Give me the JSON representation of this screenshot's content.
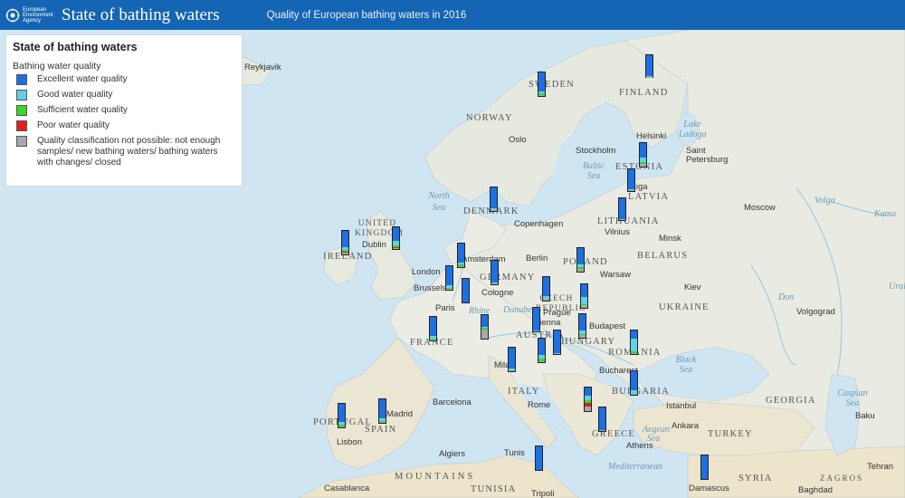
{
  "header": {
    "logo_lines": [
      "European",
      "Environment",
      "Agency"
    ],
    "title": "State of bathing waters",
    "subtitle": "Quality of European bathing waters in 2016"
  },
  "legend": {
    "title": "State of bathing waters",
    "subtitle": "Bathing water quality",
    "items": [
      {
        "label": "Excellent water quality",
        "color": "#1e6fe0"
      },
      {
        "label": "Good water quality",
        "color": "#5fd3e6"
      },
      {
        "label": "Sufficient water quality",
        "color": "#3ad42a"
      },
      {
        "label": "Poor water quality",
        "color": "#e51d1d"
      },
      {
        "label": "Quality classification not possible: not enough samples/ new bathing waters/ bathing waters with changes/ closed",
        "color": "#a8a8a8"
      }
    ]
  },
  "map": {
    "countries": [
      "SWEDEN",
      "FINLAND",
      "NORWAY",
      "ESTONIA",
      "LATVIA",
      "LITHUANIA",
      "DENMARK",
      "UNITED KINGDOM",
      "IRELAND",
      "POLAND",
      "BELARUS",
      "GERMANY",
      "CZECH REPUBLIC",
      "UKRAINE",
      "FRANCE",
      "AUSTRIA",
      "HUNGARY",
      "ROMANIA",
      "BULGARIA",
      "ITALY",
      "PORTUGAL",
      "SPAIN",
      "GREECE",
      "TURKEY",
      "GEORGIA",
      "SYRIA",
      "TUNISIA"
    ],
    "cities": [
      "Reykjavik",
      "Oslo",
      "Stockholm",
      "Helsinki",
      "Saint Petersburg",
      "Moscow",
      "Copenhagen",
      "Riga",
      "Vilnius",
      "Minsk",
      "Dublin",
      "Amsterdam",
      "Berlin",
      "Warsaw",
      "London",
      "Brussels",
      "Cologne",
      "Kiev",
      "Paris",
      "Prague",
      "Vienna",
      "Budapest",
      "Volgograd",
      "Milan",
      "Bucharest",
      "Barcelona",
      "Rome",
      "Istanbul",
      "Ankara",
      "Madrid",
      "Lisbon",
      "Algiers",
      "Tunis",
      "Athens",
      "Tehran",
      "Baku",
      "Damascus",
      "Baghdad",
      "Casablanca",
      "Tripoli"
    ],
    "seas": [
      "North Sea",
      "Baltic Sea",
      "Lake Ladoga",
      "Black Sea",
      "Caspian Sea",
      "Mediterranean",
      "Volga",
      "Kama",
      "Don",
      "Ural",
      "Danube",
      "Rhine",
      "Aegean Sea"
    ],
    "mountains": [
      "MOUNTAINS",
      "ZAGROS"
    ],
    "river_labels": [
      "Volga",
      "Kama",
      "Don",
      "Ural"
    ],
    "stations": [
      {
        "id": "sweden",
        "composition": {
          "excellent": 0.82,
          "good": 0.08,
          "sufficient": 0.05,
          "poor": 0,
          "na": 0.05
        }
      },
      {
        "id": "finland",
        "composition": {
          "excellent": 0.94,
          "good": 0.04,
          "sufficient": 0,
          "poor": 0,
          "na": 0.02
        }
      },
      {
        "id": "estonia",
        "composition": {
          "excellent": 0.6,
          "good": 0.2,
          "sufficient": 0.1,
          "poor": 0,
          "na": 0.1
        }
      },
      {
        "id": "latvia",
        "composition": {
          "excellent": 0.9,
          "good": 0.05,
          "sufficient": 0,
          "poor": 0,
          "na": 0.05
        }
      },
      {
        "id": "lithuania",
        "composition": {
          "excellent": 0.95,
          "good": 0.05,
          "sufficient": 0,
          "poor": 0,
          "na": 0
        }
      },
      {
        "id": "denmark",
        "composition": {
          "excellent": 0.9,
          "good": 0.05,
          "sufficient": 0.03,
          "poor": 0,
          "na": 0.02
        }
      },
      {
        "id": "ireland",
        "composition": {
          "excellent": 0.7,
          "good": 0.12,
          "sufficient": 0.08,
          "poor": 0.04,
          "na": 0.06
        }
      },
      {
        "id": "uk",
        "composition": {
          "excellent": 0.62,
          "good": 0.22,
          "sufficient": 0.08,
          "poor": 0.04,
          "na": 0.04
        }
      },
      {
        "id": "netherlands",
        "composition": {
          "excellent": 0.8,
          "good": 0.1,
          "sufficient": 0.05,
          "poor": 0,
          "na": 0.05
        }
      },
      {
        "id": "belgium",
        "composition": {
          "excellent": 0.82,
          "good": 0.1,
          "sufficient": 0.04,
          "poor": 0,
          "na": 0.04
        }
      },
      {
        "id": "luxembourg",
        "composition": {
          "excellent": 1,
          "good": 0,
          "sufficient": 0,
          "poor": 0,
          "na": 0
        }
      },
      {
        "id": "germany",
        "composition": {
          "excellent": 0.92,
          "good": 0.04,
          "sufficient": 0,
          "poor": 0,
          "na": 0.04
        }
      },
      {
        "id": "poland",
        "composition": {
          "excellent": 0.7,
          "good": 0.1,
          "sufficient": 0.1,
          "poor": 0,
          "na": 0.1
        }
      },
      {
        "id": "czech",
        "composition": {
          "excellent": 0.82,
          "good": 0.1,
          "sufficient": 0,
          "poor": 0,
          "na": 0.08
        }
      },
      {
        "id": "slovakia",
        "composition": {
          "excellent": 0.55,
          "good": 0.3,
          "sufficient": 0.05,
          "poor": 0,
          "na": 0.1
        }
      },
      {
        "id": "france",
        "composition": {
          "excellent": 0.8,
          "good": 0.12,
          "sufficient": 0.04,
          "poor": 0,
          "na": 0.04
        }
      },
      {
        "id": "switzerland",
        "composition": {
          "excellent": 0.5,
          "good": 0.05,
          "sufficient": 0.05,
          "poor": 0,
          "na": 0.4
        }
      },
      {
        "id": "austria",
        "composition": {
          "excellent": 0.95,
          "good": 0.05,
          "sufficient": 0,
          "poor": 0,
          "na": 0
        }
      },
      {
        "id": "hungary",
        "composition": {
          "excellent": 0.7,
          "good": 0.15,
          "sufficient": 0.05,
          "poor": 0,
          "na": 0.1
        }
      },
      {
        "id": "slovenia",
        "composition": {
          "excellent": 0.7,
          "good": 0.15,
          "sufficient": 0.1,
          "poor": 0,
          "na": 0.05
        }
      },
      {
        "id": "croatia",
        "composition": {
          "excellent": 0.95,
          "good": 0.05,
          "sufficient": 0,
          "poor": 0,
          "na": 0
        }
      },
      {
        "id": "romania",
        "composition": {
          "excellent": 0.35,
          "good": 0.55,
          "sufficient": 0.05,
          "poor": 0,
          "na": 0.05
        }
      },
      {
        "id": "bulgaria",
        "composition": {
          "excellent": 0.8,
          "good": 0.15,
          "sufficient": 0,
          "poor": 0,
          "na": 0.05
        }
      },
      {
        "id": "italy",
        "composition": {
          "excellent": 0.9,
          "good": 0.05,
          "sufficient": 0.02,
          "poor": 0.01,
          "na": 0.02
        }
      },
      {
        "id": "portugal",
        "composition": {
          "excellent": 0.75,
          "good": 0.15,
          "sufficient": 0.05,
          "poor": 0,
          "na": 0.05
        }
      },
      {
        "id": "spain",
        "composition": {
          "excellent": 0.82,
          "good": 0.1,
          "sufficient": 0.03,
          "poor": 0.02,
          "na": 0.03
        }
      },
      {
        "id": "albania",
        "composition": {
          "excellent": 0.35,
          "good": 0.2,
          "sufficient": 0.12,
          "poor": 0.15,
          "na": 0.18
        }
      },
      {
        "id": "greece",
        "composition": {
          "excellent": 0.95,
          "good": 0.03,
          "sufficient": 0,
          "poor": 0,
          "na": 0.02
        }
      },
      {
        "id": "malta",
        "composition": {
          "excellent": 1,
          "good": 0,
          "sufficient": 0,
          "poor": 0,
          "na": 0
        }
      },
      {
        "id": "cyprus",
        "composition": {
          "excellent": 1,
          "good": 0,
          "sufficient": 0,
          "poor": 0,
          "na": 0
        }
      }
    ]
  }
}
